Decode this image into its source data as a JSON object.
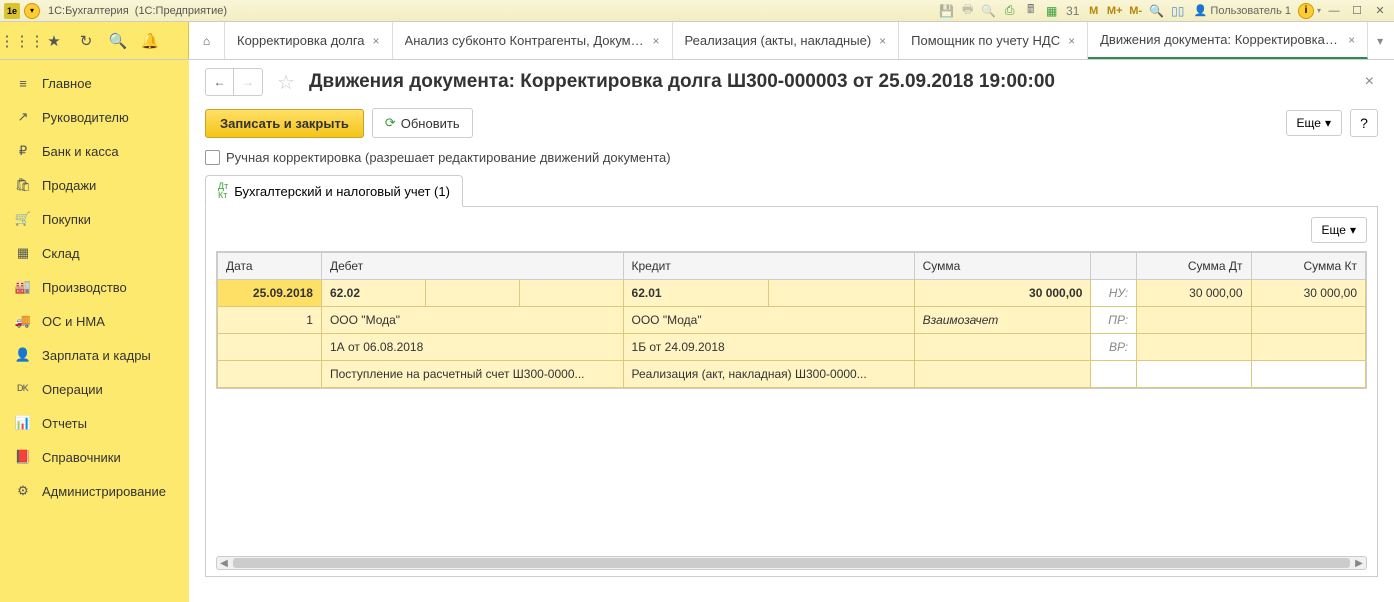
{
  "titlebar": {
    "appName": "1С:Бухгалтерия",
    "appMode": "(1С:Предприятие)",
    "m1": "M",
    "m2": "M+",
    "m3": "M-",
    "user": "Пользователь 1"
  },
  "tabs": [
    {
      "label": "Корректировка долга"
    },
    {
      "label": "Анализ субконто Контрагенты, Докумен..."
    },
    {
      "label": "Реализация (акты, накладные)"
    },
    {
      "label": "Помощник по учету НДС"
    },
    {
      "label": "Движения документа: Корректировка до..."
    }
  ],
  "sidebar": [
    {
      "icon": "≡",
      "label": "Главное"
    },
    {
      "icon": "↗",
      "label": "Руководителю"
    },
    {
      "icon": "₽",
      "label": "Банк и касса"
    },
    {
      "icon": "🛍",
      "label": "Продажи"
    },
    {
      "icon": "🛒",
      "label": "Покупки"
    },
    {
      "icon": "▦",
      "label": "Склад"
    },
    {
      "icon": "🏭",
      "label": "Производство"
    },
    {
      "icon": "🚚",
      "label": "ОС и НМА"
    },
    {
      "icon": "👤",
      "label": "Зарплата и кадры"
    },
    {
      "icon": "ᴰᴷ",
      "label": "Операции"
    },
    {
      "icon": "📊",
      "label": "Отчеты"
    },
    {
      "icon": "📕",
      "label": "Справочники"
    },
    {
      "icon": "⚙",
      "label": "Администрирование"
    }
  ],
  "header": {
    "title": "Движения документа: Корректировка долга Ш300-000003 от 25.09.2018 19:00:00"
  },
  "actions": {
    "save": "Записать и закрыть",
    "refresh": "Обновить",
    "more": "Еще",
    "help": "?"
  },
  "checkbox": {
    "label": "Ручная корректировка (разрешает редактирование движений документа)"
  },
  "subtab": {
    "label": "Бухгалтерский и налоговый учет (1)"
  },
  "table": {
    "more": "Еще",
    "headers": {
      "date": "Дата",
      "debit": "Дебет",
      "credit": "Кредит",
      "sum": "Сумма",
      "sumDt": "Сумма Дт",
      "sumKt": "Сумма Кт"
    },
    "labels": {
      "nu": "НУ:",
      "pr": "ПР:",
      "vr": "ВР:"
    },
    "rows": {
      "r1": {
        "date": "25.09.2018",
        "debit": "62.02",
        "credit": "62.01",
        "sum": "30 000,00",
        "sumDt": "30 000,00",
        "sumKt": "30 000,00"
      },
      "r2": {
        "num": "1",
        "debit": "ООО \"Мода\"",
        "credit": "ООО \"Мода\"",
        "note": "Взаимозачет"
      },
      "r3": {
        "debit": "1А от 06.08.2018",
        "credit": "1Б от 24.09.2018"
      },
      "r4": {
        "debit": "Поступление на расчетный счет Ш300-0000...",
        "credit": "Реализация (акт, накладная) Ш300-0000..."
      }
    }
  }
}
